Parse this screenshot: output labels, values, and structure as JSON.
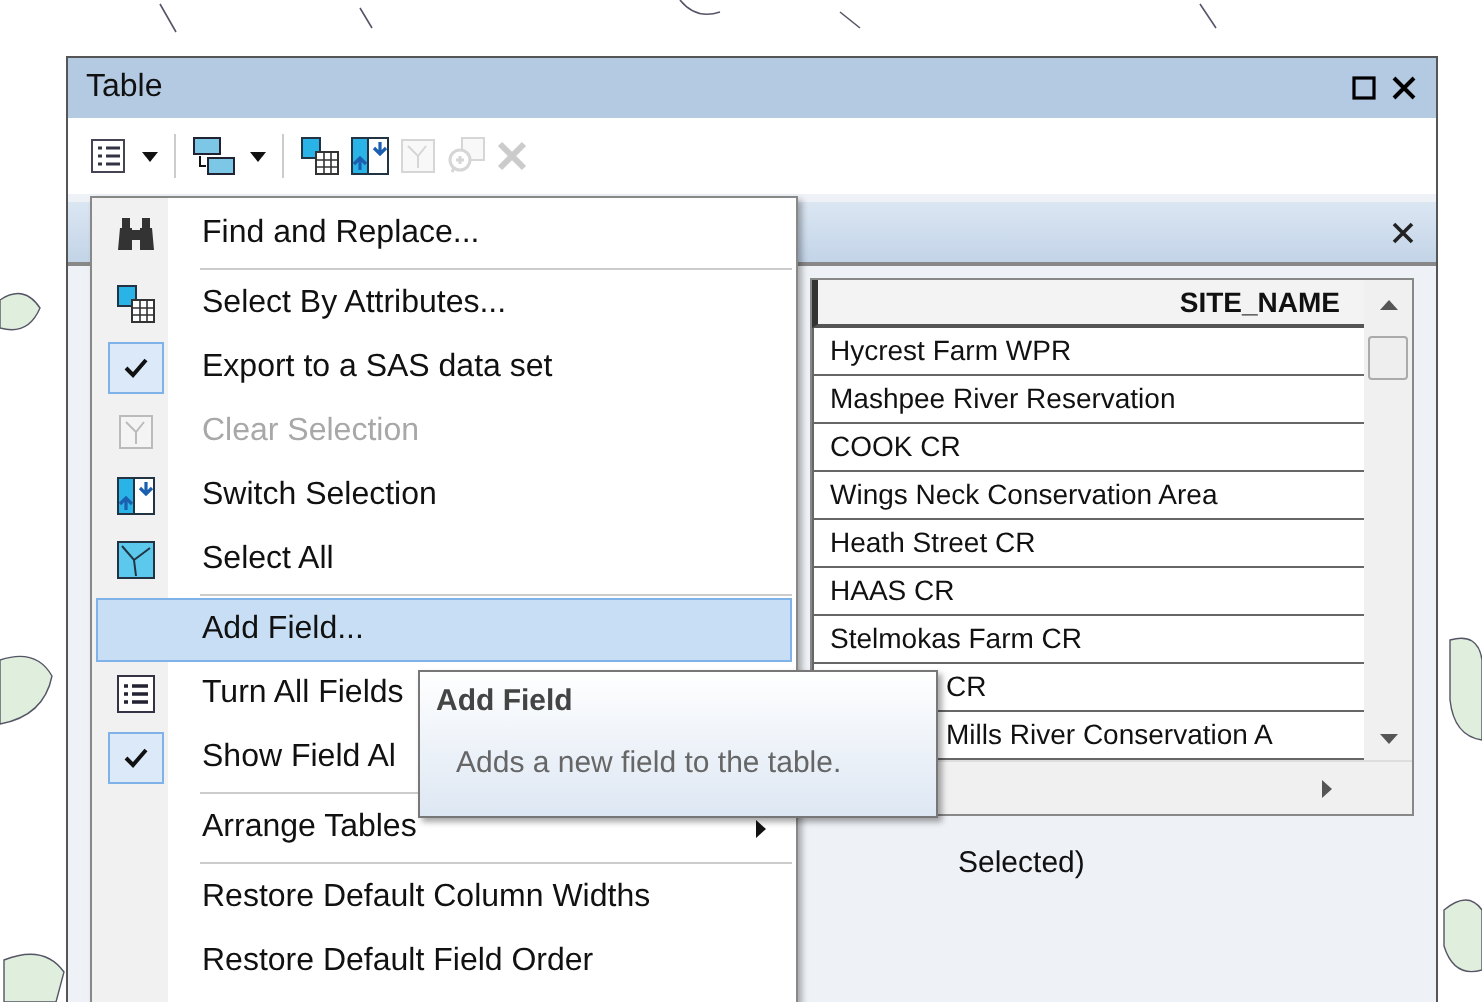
{
  "window": {
    "title": "Table"
  },
  "toolbar": [
    {
      "kind": "table-options",
      "disabled": false
    },
    {
      "kind": "related-tables",
      "disabled": false
    },
    {
      "kind": "select-by-attributes",
      "disabled": false
    },
    {
      "kind": "switch-selection",
      "disabled": false
    },
    {
      "kind": "clear-selection",
      "disabled": true
    },
    {
      "kind": "zoom-to-selected",
      "disabled": true
    },
    {
      "kind": "delete",
      "disabled": true
    }
  ],
  "table": {
    "columns": [
      "SITE_NAME"
    ],
    "rows": [
      {
        "site_name": "Hycrest Farm WPR",
        "covered": false
      },
      {
        "site_name": "Mashpee River Reservation",
        "covered": false
      },
      {
        "site_name": "COOK CR",
        "covered": false
      },
      {
        "site_name": "Wings Neck Conservation Area",
        "covered": false
      },
      {
        "site_name": "Heath Street CR",
        "covered": false
      },
      {
        "site_name": "HAAS CR",
        "covered": false
      },
      {
        "site_name": "Stelmokas Farm CR",
        "covered": false
      },
      {
        "site_name": "CR",
        "covered": true
      },
      {
        "site_name": "Mills River Conservation A",
        "covered": true
      }
    ]
  },
  "status_bar": "Selected)",
  "menu": [
    {
      "kind": "item",
      "label": "Find and Replace...",
      "checked": false,
      "disabled": false,
      "selected": false
    },
    {
      "kind": "separator"
    },
    {
      "kind": "item",
      "label": "Select By Attributes...",
      "checked": false,
      "disabled": false,
      "selected": false
    },
    {
      "kind": "item",
      "label": "Export to a SAS data set",
      "checked": true,
      "disabled": false,
      "selected": false
    },
    {
      "kind": "item",
      "label": "Clear Selection",
      "checked": false,
      "disabled": true,
      "selected": false
    },
    {
      "kind": "item",
      "label": "Switch Selection",
      "checked": false,
      "disabled": false,
      "selected": false
    },
    {
      "kind": "item",
      "label": "Select All",
      "checked": false,
      "disabled": false,
      "selected": false
    },
    {
      "kind": "separator"
    },
    {
      "kind": "item",
      "label": "Add Field...",
      "checked": false,
      "disabled": false,
      "selected": true
    },
    {
      "kind": "item",
      "label": "Turn All Fields",
      "checked": false,
      "disabled": false,
      "selected": false
    },
    {
      "kind": "item",
      "label": "Show Field Al",
      "checked": true,
      "disabled": false,
      "selected": false
    },
    {
      "kind": "separator"
    },
    {
      "kind": "submenu",
      "label": "Arrange Tables",
      "checked": false,
      "disabled": false,
      "selected": false
    },
    {
      "kind": "separator"
    },
    {
      "kind": "item",
      "label": "Restore Default Column Widths",
      "checked": false,
      "disabled": false,
      "selected": false
    },
    {
      "kind": "item",
      "label": "Restore Default Field Order",
      "checked": false,
      "disabled": false,
      "selected": false
    }
  ],
  "tooltip": {
    "title": "Add Field",
    "text": "Adds a new field to the table."
  }
}
